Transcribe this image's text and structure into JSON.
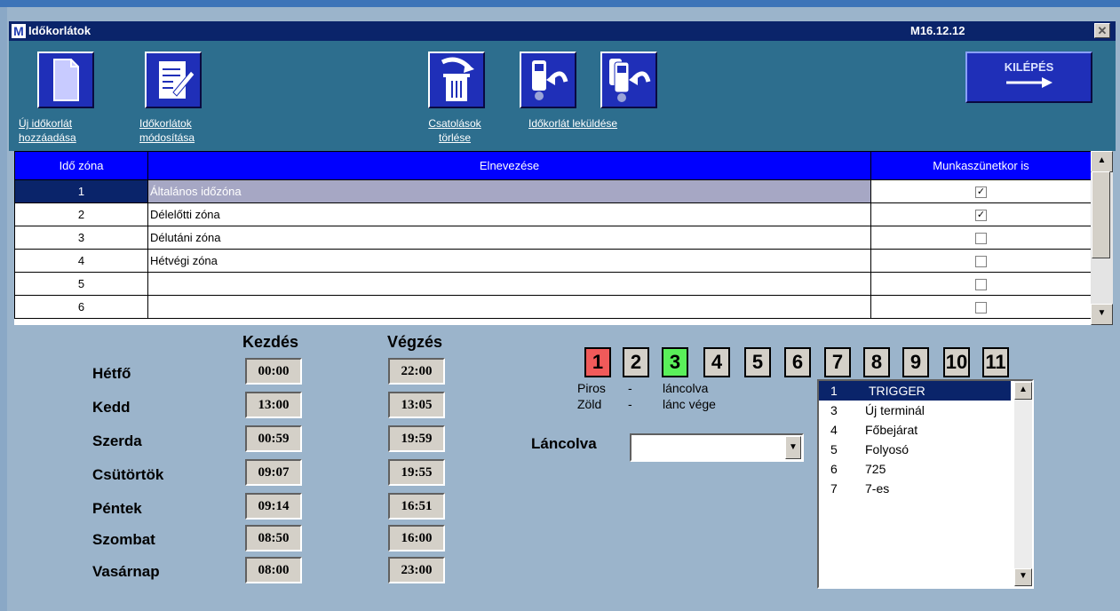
{
  "window": {
    "logo": "M",
    "title": "Időkorlátok",
    "version": "M16.12.12",
    "close": "✕"
  },
  "toolbar": {
    "add_label": [
      "Új időkorlát",
      "hozzáadása"
    ],
    "modify_label": [
      "Időkorlátok",
      "módosítása"
    ],
    "delete_label": [
      "Csatolások",
      "törlése"
    ],
    "send_label": "Időkorlát leküldése",
    "exit_label": "KILÉPÉS"
  },
  "grid": {
    "headers": [
      "Idő zóna",
      "Elnevezése",
      "Munkaszünetkor is"
    ],
    "rows": [
      {
        "num": "1",
        "name": "Általános időzóna",
        "holiday": true,
        "selected": true
      },
      {
        "num": "2",
        "name": "Délelőtti zóna",
        "holiday": true,
        "selected": false
      },
      {
        "num": "3",
        "name": "Délutáni zóna",
        "holiday": false,
        "selected": false
      },
      {
        "num": "4",
        "name": "Hétvégi zóna",
        "holiday": false,
        "selected": false
      },
      {
        "num": "5",
        "name": "",
        "holiday": false,
        "selected": false
      },
      {
        "num": "6",
        "name": "",
        "holiday": false,
        "selected": false
      }
    ]
  },
  "schedule": {
    "start_header": "Kezdés",
    "end_header": "Végzés",
    "days": [
      {
        "day": "Hétfő",
        "start": "00:00",
        "end": "22:00"
      },
      {
        "day": "Kedd",
        "start": "13:00",
        "end": "13:05"
      },
      {
        "day": "Szerda",
        "start": "00:59",
        "end": "19:59"
      },
      {
        "day": "Csütörtök",
        "start": "09:07",
        "end": "19:55"
      },
      {
        "day": "Péntek",
        "start": "09:14",
        "end": "16:51"
      },
      {
        "day": "Szombat",
        "start": "08:50",
        "end": "16:00"
      },
      {
        "day": "Vasárnap",
        "start": "08:00",
        "end": "23:00"
      }
    ]
  },
  "chain": {
    "boxes": [
      {
        "n": "1",
        "color": "#f05a5a"
      },
      {
        "n": "2",
        "color": "#d4d0c8"
      },
      {
        "n": "3",
        "color": "#5af05a"
      },
      {
        "n": "4",
        "color": "#d4d0c8"
      },
      {
        "n": "5",
        "color": "#d4d0c8"
      },
      {
        "n": "6",
        "color": "#d4d0c8"
      },
      {
        "n": "7",
        "color": "#d4d0c8"
      },
      {
        "n": "8",
        "color": "#d4d0c8"
      },
      {
        "n": "9",
        "color": "#d4d0c8"
      },
      {
        "n": "10",
        "color": "#d4d0c8"
      },
      {
        "n": "11",
        "color": "#d4d0c8"
      }
    ],
    "legend_red": "Piros",
    "legend_red_dash": "-",
    "legend_red_text": "láncolva",
    "legend_green": "Zöld",
    "legend_green_dash": "-",
    "legend_green_text": "lánc vége",
    "chained_label": "Láncolva",
    "chained_value": ""
  },
  "terminals": [
    {
      "n": "1",
      "name": "TRIGGER",
      "selected": true
    },
    {
      "n": "3",
      "name": "Új terminál",
      "selected": false
    },
    {
      "n": "4",
      "name": "Főbejárat",
      "selected": false
    },
    {
      "n": "5",
      "name": "Folyosó",
      "selected": false
    },
    {
      "n": "6",
      "name": "725",
      "selected": false
    },
    {
      "n": "7",
      "name": "7-es",
      "selected": false
    }
  ]
}
